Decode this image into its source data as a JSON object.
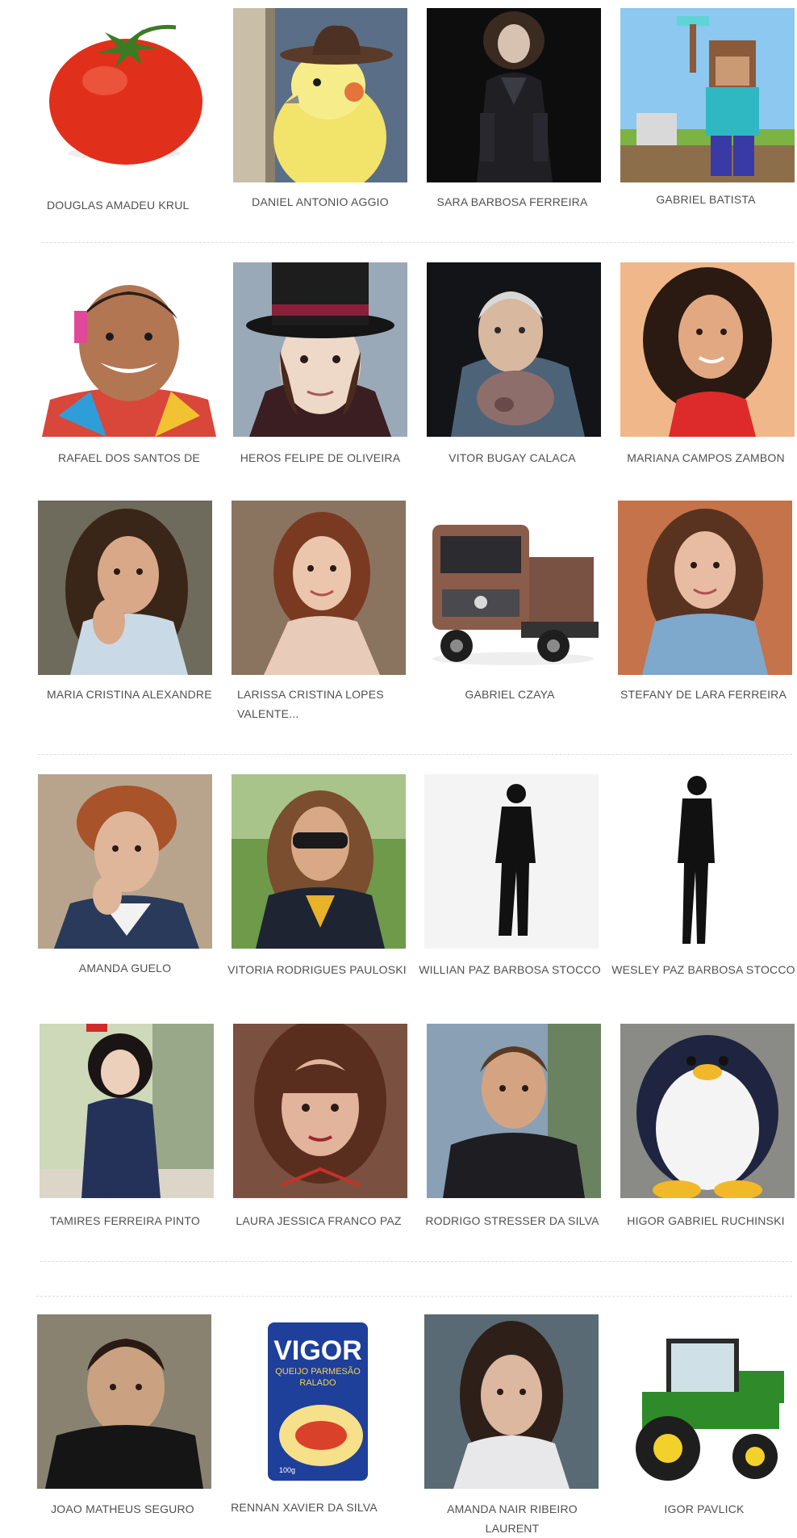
{
  "gallery": {
    "rows": [
      {
        "cards": [
          {
            "name": "DOUGLAS AMADEU KRUL",
            "image": "tomato"
          },
          {
            "name": "DANIEL ANTONIO AGGIO",
            "image": "cockatiel-with-hat"
          },
          {
            "name": "SARA BARBOSA FERREIRA",
            "image": "woman-dark-gown"
          },
          {
            "name": "GABRIEL BATISTA",
            "image": "minecraft-steve"
          }
        ]
      },
      {
        "cards": [
          {
            "name": "RAFAEL DOS SANTOS DE",
            "image": "smiling-man-colorful-shirt"
          },
          {
            "name": "HEROS FELIPE DE OLIVEIRA",
            "image": "man-top-hat"
          },
          {
            "name": "VITOR BUGAY CALACA",
            "image": "older-man-with-pig"
          },
          {
            "name": "MARIANA CAMPOS ZAMBON",
            "image": "woman-curly-hair-red-top"
          }
        ]
      },
      {
        "cards": [
          {
            "name": "MARIA CRISTINA ALEXANDRE",
            "image": "woman-long-hair-portrait"
          },
          {
            "name": "LARISSA CRISTINA LOPES VALENTE...",
            "image": "woman-auburn-hair"
          },
          {
            "name": "GABRIEL CZAYA",
            "image": "truck"
          },
          {
            "name": "STEFANY DE LARA FERREIRA",
            "image": "woman-denim-jacket"
          }
        ]
      },
      {
        "cards": [
          {
            "name": "AMANDA GUELO",
            "image": "older-woman-red-hair"
          },
          {
            "name": "VITORIA RODRIGUES PAULOSKI",
            "image": "woman-sunglasses"
          },
          {
            "name": "WILLIAN PAZ BARBOSA STOCCO",
            "image": "man-silhouette"
          },
          {
            "name": "WESLEY PAZ BARBOSA STOCCO",
            "image": "man-silhouette-walking"
          }
        ]
      },
      {
        "cards": [
          {
            "name": "TAMIRES FERREIRA PINTO",
            "image": "girl-in-hallway"
          },
          {
            "name": "LAURA JESSICA FRANCO PAZ",
            "image": "woman-bangs-portrait"
          },
          {
            "name": "RODRIGO STRESSER DA SILVA",
            "image": "young-man-dark-shirt"
          },
          {
            "name": "HIGOR GABRIEL RUCHINSKI",
            "image": "penguin-plush"
          }
        ]
      },
      {
        "cards": [
          {
            "name": "JOAO MATHEUS SEGURO",
            "image": "man-dark-shirt-portrait"
          },
          {
            "name": "RENNAN XAVIER DA SILVA",
            "image": "vigor-parmesan-package"
          },
          {
            "name": "AMANDA NAIR RIBEIRO LAURENT",
            "image": "young-woman-portrait"
          },
          {
            "name": "IGOR PAVLICK",
            "image": "green-tractor"
          }
        ]
      }
    ],
    "vigor_package": {
      "brand": "VIGOR",
      "line1": "QUEIJO PARMESÃO",
      "line2": "RALADO",
      "weight": "100g"
    }
  }
}
